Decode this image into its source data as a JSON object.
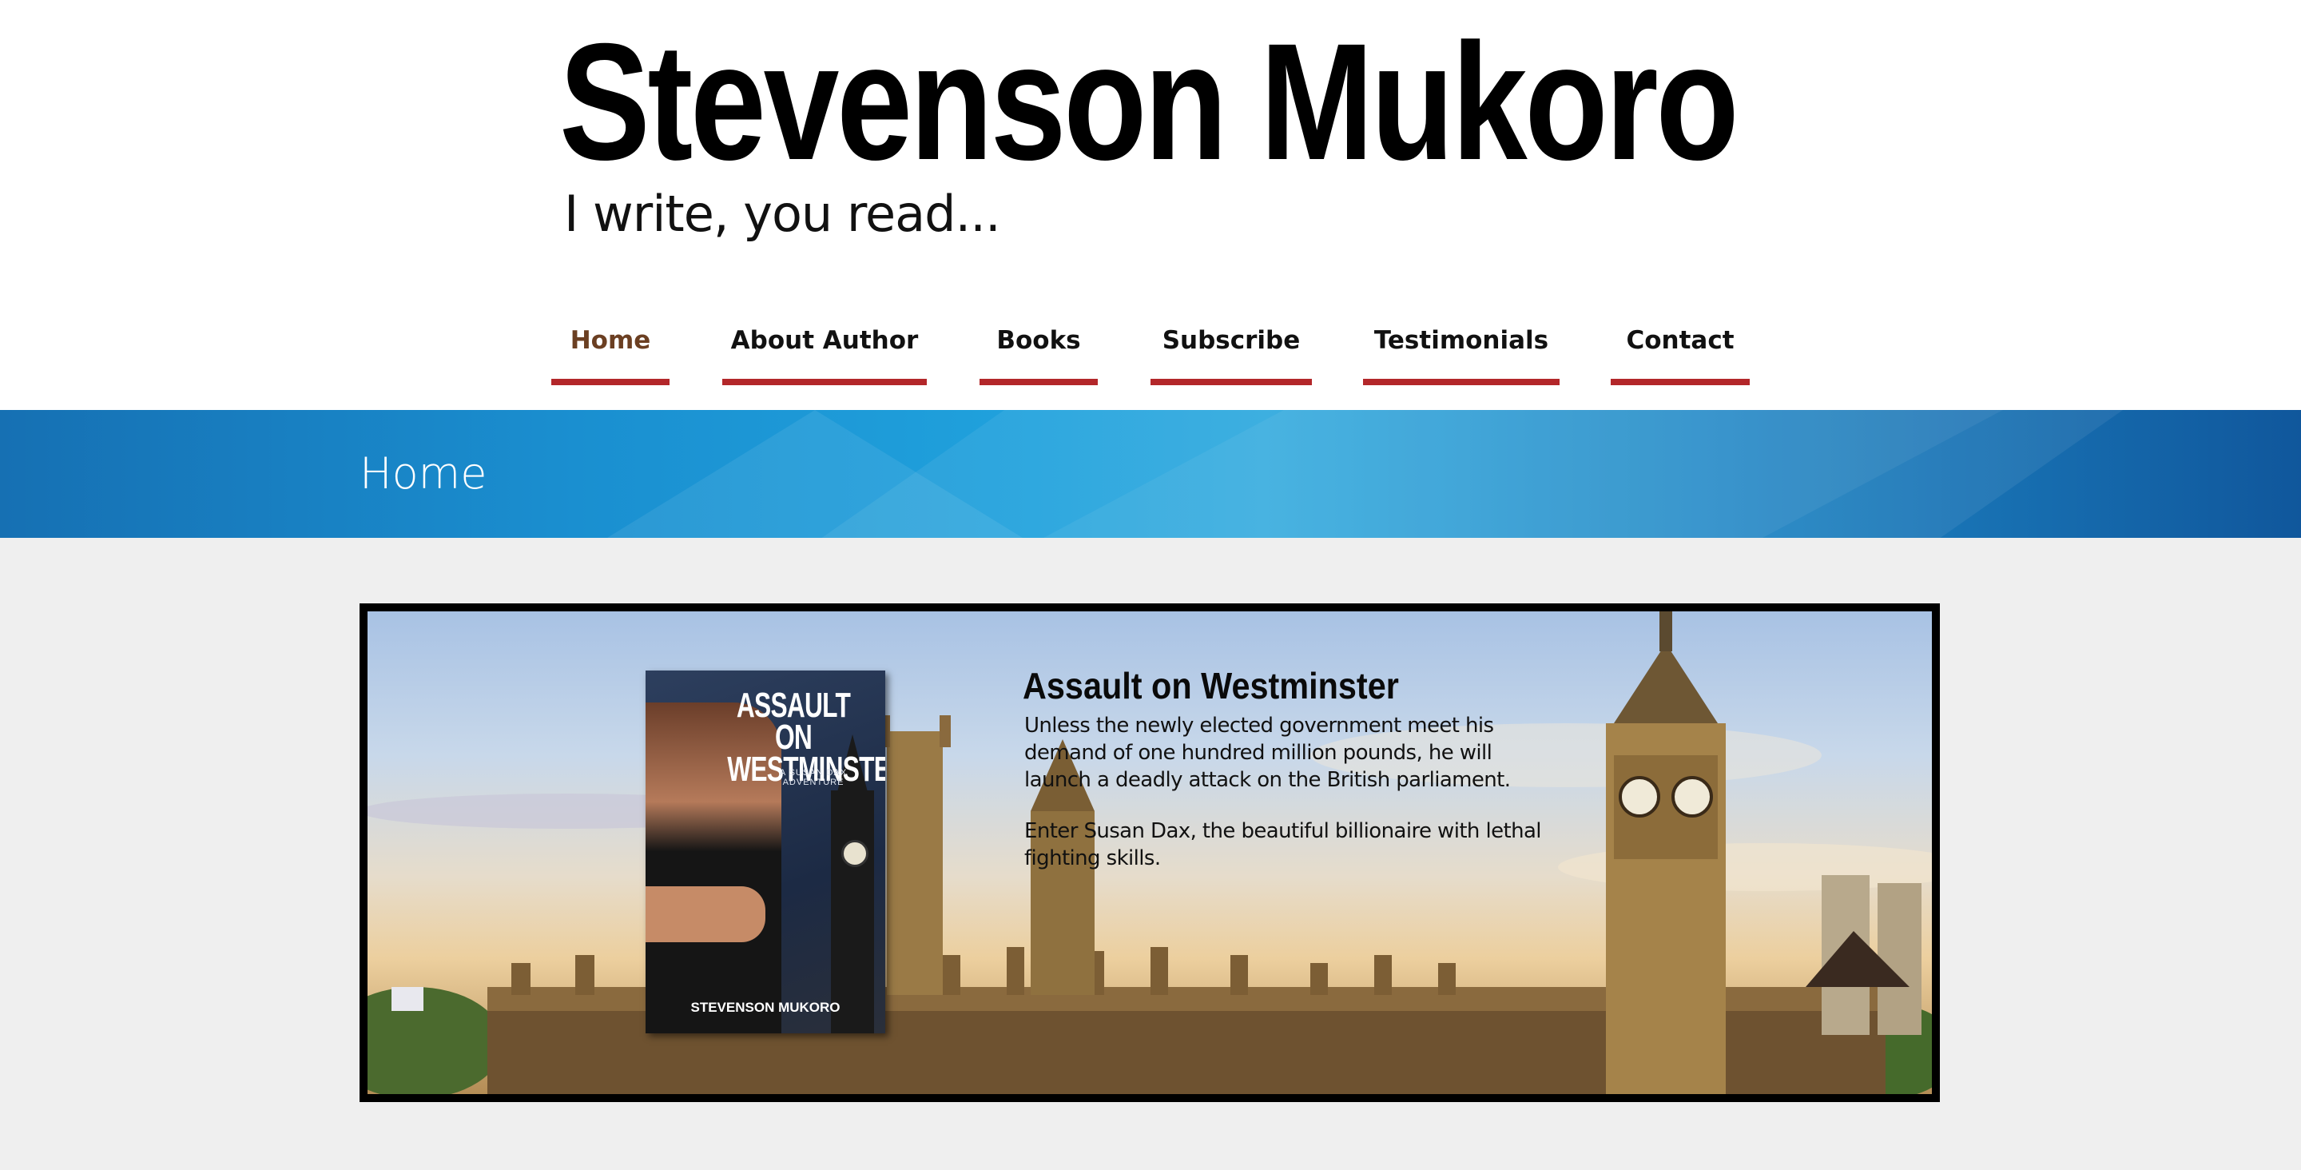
{
  "site": {
    "title": "Stevenson Mukoro",
    "tagline": "I write, you read..."
  },
  "nav": {
    "items": [
      {
        "label": "Home",
        "active": true
      },
      {
        "label": "About Author",
        "active": false
      },
      {
        "label": "Books",
        "active": false
      },
      {
        "label": "Subscribe",
        "active": false
      },
      {
        "label": "Testimonials",
        "active": false
      },
      {
        "label": "Contact",
        "active": false
      }
    ]
  },
  "page": {
    "heading": "Home"
  },
  "banner": {
    "book_title": "ASSAULT ON WESTMINSTER",
    "book_subtitle": "A SUSAN DAX ADVENTURE",
    "book_author": "STEVENSON MUKORO",
    "promo_title": "Assault on Westminster",
    "promo_paragraph_1": "Unless the newly elected government meet his demand of one hundred million pounds, he will launch a deadly attack on the British parliament.",
    "promo_paragraph_2": "Enter Susan Dax, the beautiful billionaire with lethal fighting skills."
  },
  "colors": {
    "nav_underline": "#b3272a",
    "nav_active_text": "#6b3f22",
    "band_blue": "#1a8fd0",
    "content_bg": "#efefef"
  }
}
